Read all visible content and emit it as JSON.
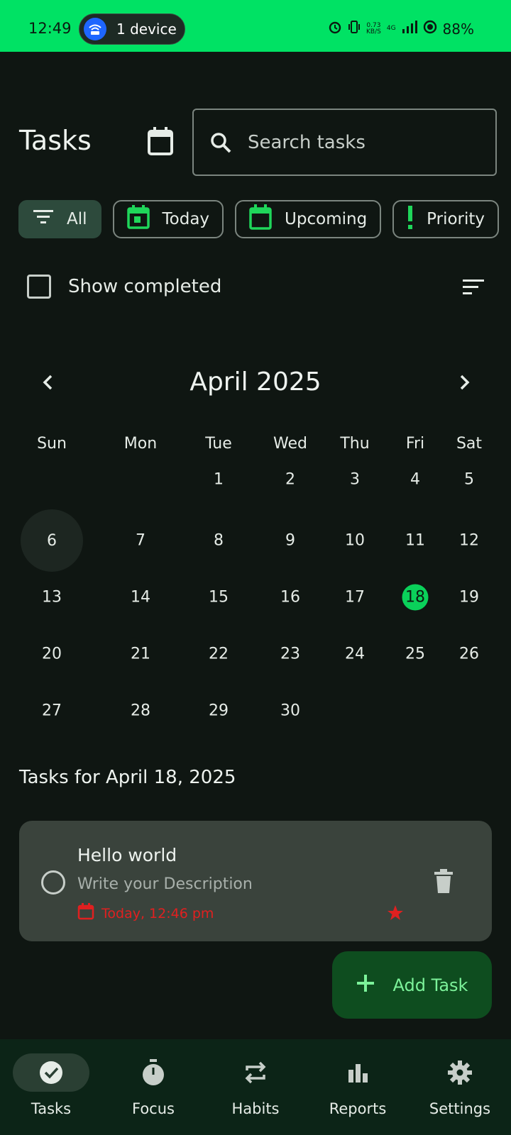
{
  "status_bar": {
    "time": "12:49",
    "devices_pill": "1 device",
    "speed_top": "0.73",
    "speed_unit": "KB/S",
    "network": "4G",
    "battery": "88%"
  },
  "header": {
    "title": "Tasks",
    "search_placeholder": "Search tasks"
  },
  "filters": [
    {
      "label": "All",
      "icon": "filter-icon",
      "selected": true
    },
    {
      "label": "Today",
      "icon": "calendar-today-icon",
      "selected": false
    },
    {
      "label": "Upcoming",
      "icon": "calendar-icon",
      "selected": false
    },
    {
      "label": "Priority",
      "icon": "priority-icon",
      "selected": false
    }
  ],
  "show_completed": {
    "label": "Show completed",
    "checked": false
  },
  "calendar": {
    "month_label": "April 2025",
    "weekdays": [
      "Sun",
      "Mon",
      "Tue",
      "Wed",
      "Thu",
      "Fri",
      "Sat"
    ],
    "weeks": [
      [
        "",
        "",
        "1",
        "2",
        "3",
        "4",
        "5"
      ],
      [
        "6",
        "7",
        "8",
        "9",
        "10",
        "11",
        "12"
      ],
      [
        "13",
        "14",
        "15",
        "16",
        "17",
        "18",
        "19"
      ],
      [
        "20",
        "21",
        "22",
        "23",
        "24",
        "25",
        "26"
      ],
      [
        "27",
        "28",
        "29",
        "30",
        "",
        "",
        ""
      ]
    ],
    "highlighted_day": "6",
    "today": "18"
  },
  "tasks_section": {
    "title": "Tasks for April 18, 2025"
  },
  "task": {
    "title": "Hello world",
    "description": "Write your Description",
    "due": "Today, 12:46 pm",
    "starred": true
  },
  "fab": {
    "label": "Add Task"
  },
  "bottom_nav": [
    {
      "label": "Tasks",
      "icon": "check-circle-icon",
      "selected": true
    },
    {
      "label": "Focus",
      "icon": "timer-icon",
      "selected": false
    },
    {
      "label": "Habits",
      "icon": "repeat-icon",
      "selected": false
    },
    {
      "label": "Reports",
      "icon": "bar-chart-icon",
      "selected": false
    },
    {
      "label": "Settings",
      "icon": "gear-icon",
      "selected": false
    }
  ],
  "colors": {
    "accent": "#00e264",
    "background": "#0f1612",
    "card": "#3a433c",
    "due_red": "#e02020",
    "fab_bg": "#0e4d1f"
  }
}
